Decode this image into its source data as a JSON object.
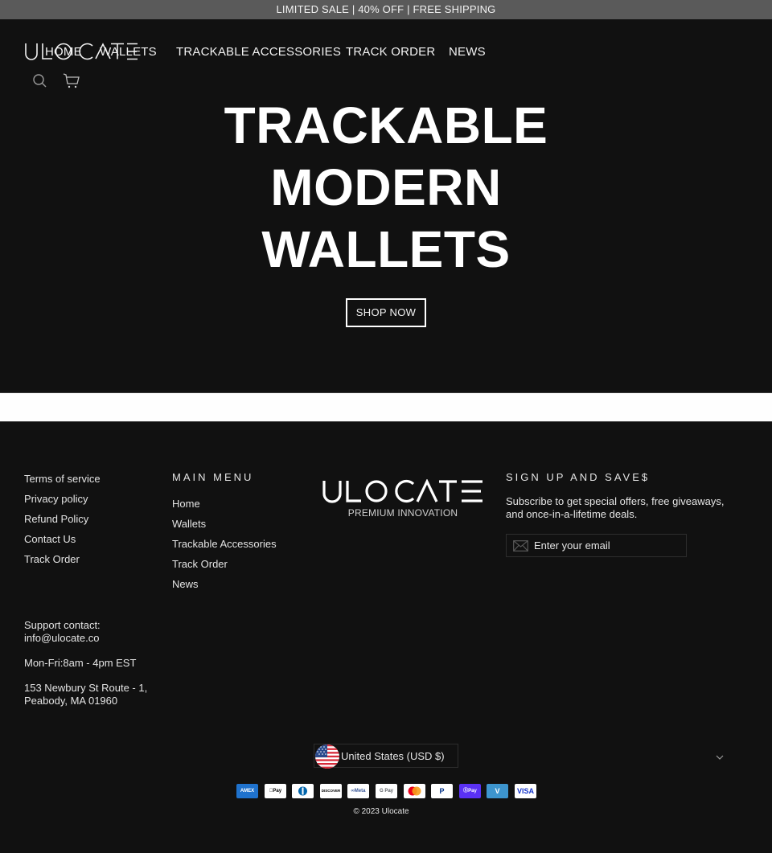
{
  "announcement": "LIMITED SALE | 40% OFF | FREE SHIPPING",
  "brand": {
    "name": "ULOCATE",
    "tagline": "PREMIUM INNOVATION"
  },
  "nav": {
    "items": [
      {
        "label": "HOME"
      },
      {
        "label": "WALLETS"
      },
      {
        "label": "TRACKABLE ACCESSORIES"
      },
      {
        "label": "TRACK ORDER"
      },
      {
        "label": "NEWS"
      }
    ],
    "icons": [
      "search-icon",
      "cart-icon"
    ]
  },
  "hero": {
    "title_lines": [
      "TRACKABLE",
      "MODERN",
      "WALLETS"
    ],
    "cta_label": "SHOP NOW"
  },
  "footer": {
    "policy_links": [
      "Terms of service",
      "Privacy policy",
      "Refund Policy",
      "Contact Us",
      "Track Order"
    ],
    "support": {
      "label": "Support contact:",
      "email": "info@ulocate.co",
      "hours": "Mon-Fri:8am - 4pm EST",
      "address_line1": "153 Newbury St Route - 1,",
      "address_line2": "Peabody, MA 01960"
    },
    "main_menu": {
      "heading": "MAIN MENU",
      "items": [
        "Home",
        "Wallets",
        "Trackable Accessories",
        "Track Order",
        "News"
      ]
    },
    "newsletter": {
      "heading": "SIGN UP AND SAVE$",
      "text": "Subscribe to get special offers, free giveaways, and once-in-a-lifetime deals.",
      "email_placeholder": "Enter your email",
      "email_value": ""
    },
    "currency": {
      "selected": "United States (USD $)"
    },
    "payment_methods": [
      {
        "name": "American Express",
        "label": "AMEX",
        "bg": "#1f72cd",
        "fg": "#ffffff"
      },
      {
        "name": "Apple Pay",
        "label": "Pay",
        "bg": "#ffffff",
        "fg": "#000000"
      },
      {
        "name": "Diners Club",
        "label": "D",
        "bg": "#ffffff",
        "fg": "#0165ac"
      },
      {
        "name": "Discover",
        "label": "DISCOVER",
        "bg": "#ffffff",
        "fg": "#000000"
      },
      {
        "name": "Meta Pay",
        "label": "∞Meta",
        "bg": "#ffffff",
        "fg": "#3c5a9a"
      },
      {
        "name": "Google Pay",
        "label": "G Pay",
        "bg": "#ffffff",
        "fg": "#5f6368"
      },
      {
        "name": "Mastercard",
        "label": "",
        "bg": "#ffffff",
        "fg": "#000000"
      },
      {
        "name": "PayPal",
        "label": "P",
        "bg": "#ffffff",
        "fg": "#003087"
      },
      {
        "name": "Shop Pay",
        "label": "Pay",
        "bg": "#5a31f4",
        "fg": "#ffffff"
      },
      {
        "name": "Venmo",
        "label": "V",
        "bg": "#3d95ce",
        "fg": "#ffffff"
      },
      {
        "name": "Visa",
        "label": "VISA",
        "bg": "#ffffff",
        "fg": "#1434cb"
      }
    ],
    "copyright": "© 2023 Ulocate"
  },
  "colors": {
    "announcement_bg": "#5a5a5a",
    "page_bg": "#111111",
    "band_bg": "#fefefe",
    "text": "#e4e4e4"
  }
}
